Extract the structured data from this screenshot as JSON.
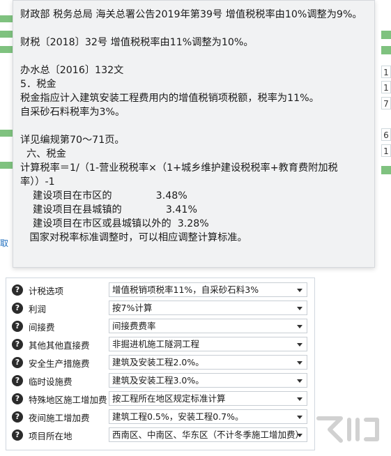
{
  "tooltip": {
    "lines": [
      "财政部 税务总局 海关总署公告2019年第39号 增值税税率由10%调整为9%。",
      "",
      "财税〔2018〕32号 增值税税率由11%调整为10%。",
      "",
      "办水总〔2016〕132文",
      "5．税金",
      "税金指应计入建筑安装工程费用内的增值税销项税额，税率为11%。",
      "自采砂石料税率为3%。",
      "",
      "详见编规第70～71页。",
      "  六、税金",
      "计算税率＝1/（1-营业税税率×（1+城乡维护建设税税率+教育费附加税率））-1",
      "    建设项目在市区的              3.48%",
      "    建设项目在县城镇的              3.41%",
      "    建设项目在市区或县城镇以外的  3.28%",
      "   国家对税率标准调整时，可以相应调整计算标准。"
    ]
  },
  "background": {
    "left_link": "取",
    "right_numbers": [
      "1",
      "1",
      "7",
      "6",
      "1"
    ]
  },
  "settings": {
    "rows": [
      {
        "label": "计税选项",
        "value": "增值税销项税率11%，自采砂石料3%"
      },
      {
        "label": "利润",
        "value": "按7%计算"
      },
      {
        "label": "间接费",
        "value": "间接费费率"
      },
      {
        "label": "其他其他直接费",
        "value": "非掘进机施工隧洞工程"
      },
      {
        "label": "安全生产措施费",
        "value": "建筑及安装工程2.0%。"
      },
      {
        "label": "临时设施费",
        "value": "建筑及安装工程3.0%。"
      },
      {
        "label": "特殊地区施工增加费",
        "value": "按工程所在地区规定标准计算"
      },
      {
        "label": "夜间施工增加费",
        "value": "建筑工程0.5%，安装工程0.7%。"
      },
      {
        "label": "项目所在地",
        "value": "西南区、中南区、华东区（不计冬季施工增加费）"
      }
    ]
  },
  "icons": {
    "help": "question-circle-icon",
    "dropdown": "chevron-down-icon"
  }
}
